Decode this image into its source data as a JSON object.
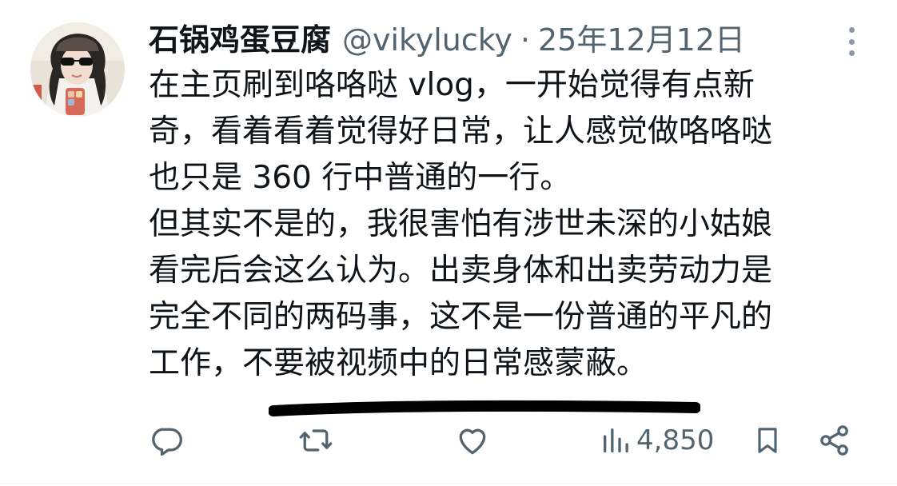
{
  "author": {
    "display_name": "石锅鸡蛋豆腐",
    "handle": "@vikylucky",
    "separator": "·",
    "date": "25年12月12日"
  },
  "tweet": {
    "lines": [
      "在主页刷到咯咯哒 vlog，一开始觉得有点新",
      "奇，看着看着觉得好日常，让人感觉做咯咯哒",
      "也只是 360 行中普通的一行。",
      "但其实不是的，我很害怕有涉世未深的小姑娘",
      "看完后会这么认为。出卖身体和出卖劳动力是",
      "完全不同的两码事，这不是一份普通的平凡的",
      "工作，不要被视频中的日常感蒙蔽。"
    ]
  },
  "actions": {
    "views": "4,850"
  },
  "icons": {
    "more": "more-vertical-icon",
    "reply": "reply-icon",
    "retweet": "retweet-icon",
    "like": "heart-icon",
    "views": "views-bar-chart-icon",
    "bookmark": "bookmark-icon",
    "share": "share-icon"
  },
  "colors": {
    "text": "#0f1419",
    "secondary": "#536471",
    "underline_marker": "#000000"
  }
}
